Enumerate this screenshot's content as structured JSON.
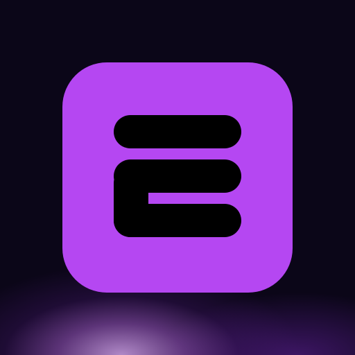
{
  "icon": {
    "semantic": "e-logo-icon",
    "tile_color": "#b547f2",
    "glyph_color": "#000000"
  },
  "background": {
    "base_color": "#0b0618",
    "glow_color": "#c89ae0"
  }
}
